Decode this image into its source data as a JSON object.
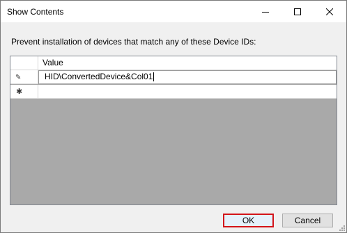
{
  "window": {
    "title": "Show Contents"
  },
  "prompt": "Prevent installation of devices that match any of these Device IDs:",
  "table": {
    "column_header": "Value",
    "rows": [
      {
        "value": "HID\\ConvertedDevice&Col01",
        "indicator": "edit-pencil"
      },
      {
        "value": "",
        "indicator": "new-row-asterisk"
      }
    ]
  },
  "buttons": {
    "ok_label": "OK",
    "cancel_label": "Cancel"
  },
  "colors": {
    "highlight_border": "#d3141a",
    "grid_background": "#a9a9a9"
  }
}
